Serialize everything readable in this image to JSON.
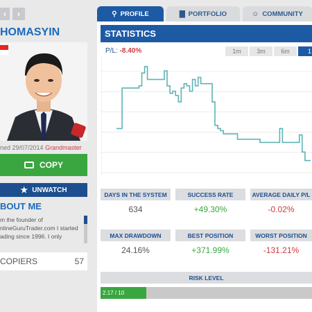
{
  "profile": {
    "username": "HOMASYIN",
    "joined_text": "ned 29/07/2014",
    "rank": "Grandmaster"
  },
  "actions": {
    "copy_label": "COPY",
    "unwatch_label": "UNWATCH"
  },
  "about": {
    "title": "BOUT ME",
    "text": "m the founder of nlineGuruTrader.com I started ading since 1996. I only"
  },
  "copiers": {
    "label": "COPIERS",
    "count": "57"
  },
  "tabs": [
    {
      "label": "PROFILE",
      "icon": "tie-icon",
      "active": true
    },
    {
      "label": "PORTFOLIO",
      "icon": "bar-chart-icon",
      "active": false
    },
    {
      "label": "COMMUNITY",
      "icon": "people-icon",
      "active": false
    }
  ],
  "statistics": {
    "title": "STATISTICS",
    "pl_label": "P/L:",
    "pl_value": "-8.40%",
    "ranges": [
      "1m",
      "3m",
      "6m",
      "1"
    ],
    "active_range_index": 3
  },
  "stats": [
    {
      "label": "DAYS IN THE SYSTEM",
      "value": "634",
      "tone": "neutral"
    },
    {
      "label": "SUCCESS RATE",
      "value": "+49.30%",
      "tone": "pos"
    },
    {
      "label": "AVERAGE DAILY P/L",
      "value": "-0.02%",
      "tone": "neg"
    },
    {
      "label": "MAX DRAWDOWN",
      "value": "24.16%",
      "tone": "neutral"
    },
    {
      "label": "BEST POSITION",
      "value": "+371.99%",
      "tone": "pos"
    },
    {
      "label": "WORST POSITION",
      "value": "-131.21%",
      "tone": "neg"
    }
  ],
  "risk": {
    "label": "RISK LEVEL",
    "value_text": "2.17 / 10",
    "fraction": 0.217
  },
  "chart_data": {
    "type": "line",
    "title": "",
    "xlabel": "",
    "ylabel": "",
    "grid": true,
    "color": "#5fb3b3",
    "values": [
      0.4,
      0.4,
      0.78,
      0.78,
      0.78,
      0.78,
      0.78,
      0.78,
      0.8,
      0.92,
      0.98,
      0.86,
      0.86,
      0.86,
      0.86,
      0.86,
      0.86,
      0.94,
      0.8,
      0.73,
      0.75,
      0.71,
      0.65,
      0.78,
      0.82,
      0.8,
      0.75,
      0.86,
      0.8,
      0.88,
      0.82,
      0.82,
      0.82,
      0.82,
      0.65,
      0.43,
      0.4,
      0.38,
      0.35,
      0.35,
      0.35,
      0.35,
      0.35,
      0.3,
      0.3,
      0.3,
      0.3,
      0.3,
      0.3,
      0.3,
      0.3,
      0.27,
      0.27,
      0.27,
      0.27,
      0.27,
      0.27,
      0.27,
      0.4,
      0.27,
      0.27,
      0.27,
      0.27,
      0.27,
      0.27,
      0.34,
      0.18,
      0.1,
      0.1,
      0.1
    ]
  },
  "colors": {
    "brand_blue": "#1d5aa4",
    "green": "#3aa640",
    "red": "#d0393e"
  }
}
